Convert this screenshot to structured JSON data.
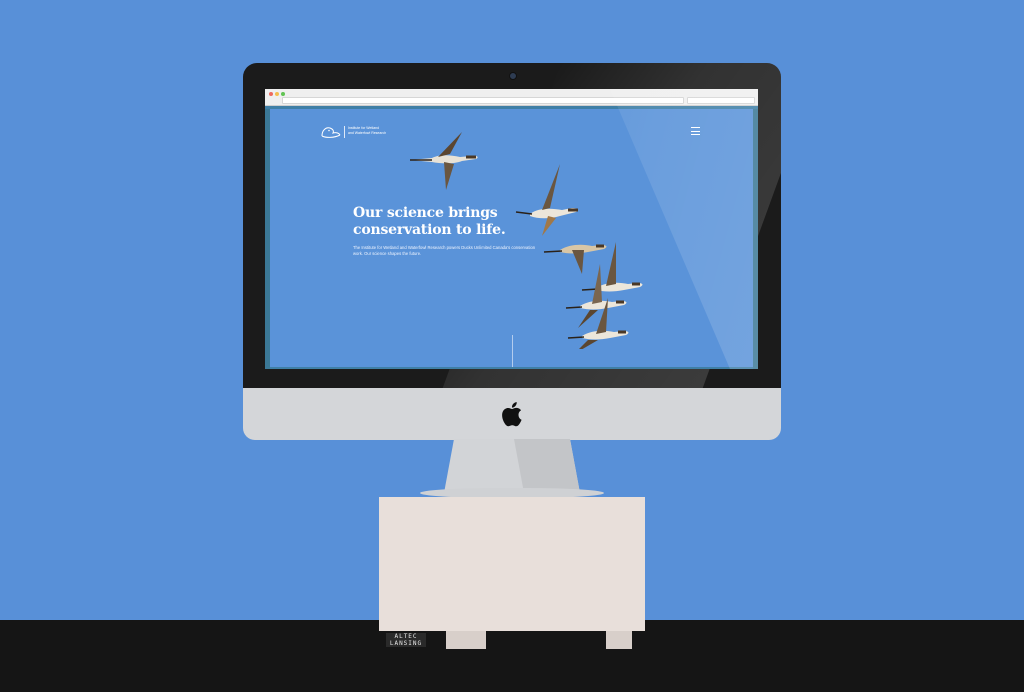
{
  "page": {
    "logo_line1": "Institute for Wetland",
    "logo_line2": "and Waterfowl Research",
    "headline_line1": "Our science brings",
    "headline_line2": "conservation to life.",
    "body_text": "The Institute for Wetland and Waterfowl Research powers Ducks Unlimited Canada's conservation work. Our science shapes the future."
  },
  "speaker": {
    "brand_line1": "ALTEC",
    "brand_line2": "LANSING"
  },
  "colors": {
    "background": "#5890d8",
    "page_background": "#5a93d9",
    "floor": "#151515"
  },
  "icons": {
    "menu": "hamburger-menu-icon",
    "logo": "duck-logo-icon",
    "apple": "apple-logo-icon"
  }
}
